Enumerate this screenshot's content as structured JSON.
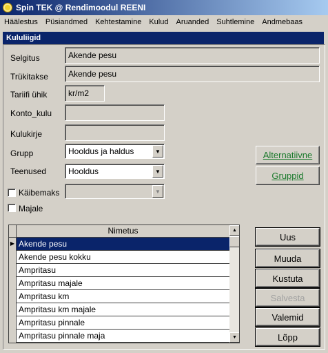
{
  "window": {
    "title": "Spin TEK @ Rendimoodul REENI"
  },
  "menu": [
    "Häälestus",
    "Püsiandmed",
    "Kehtestamine",
    "Kulud",
    "Aruanded",
    "Suhtlemine",
    "Andmebaas"
  ],
  "section_title": "Kululiigid",
  "form": {
    "selgitus": {
      "label": "Selgitus",
      "value": "Akende pesu"
    },
    "trukitakse": {
      "label": "Trükitakse",
      "value": "Akende pesu"
    },
    "tariifi_uhik": {
      "label": "Tariifi ühik",
      "value": "kr/m2"
    },
    "konto_kulu": {
      "label": "Konto_kulu",
      "value": ""
    },
    "kulukirje": {
      "label": "Kulukirje",
      "value": ""
    },
    "grupp": {
      "label": "Grupp",
      "value": "Hooldus ja haldus"
    },
    "teenused": {
      "label": "Teenused",
      "value": "Hooldus"
    },
    "kaibemaks": {
      "label": "Käibemaks",
      "value": "",
      "checked": false
    },
    "majale": {
      "label": "Majale",
      "checked": false
    }
  },
  "side_buttons": {
    "alternatiivne": "Alternatiivne",
    "gruppid": "Gruppid"
  },
  "grid": {
    "column": "Nimetus",
    "rows": [
      "Akende pesu",
      "Akende pesu kokku",
      "Ampritasu",
      "Ampritasu  majale",
      "Ampritasu km",
      "Ampritasu km majale",
      "Ampritasu pinnale",
      "Ampritasu pinnale maja"
    ],
    "selected_index": 0
  },
  "action_buttons": {
    "uus": "Uus",
    "muuda": "Muuda",
    "kustuta": "Kustuta",
    "salvesta": "Salvesta",
    "valemid": "Valemid",
    "lopp": "Lõpp"
  },
  "colors": {
    "title_start": "#0a246a",
    "title_end": "#a6caf0",
    "selection": "#0a246a",
    "link_green": "#1b7a2c"
  }
}
